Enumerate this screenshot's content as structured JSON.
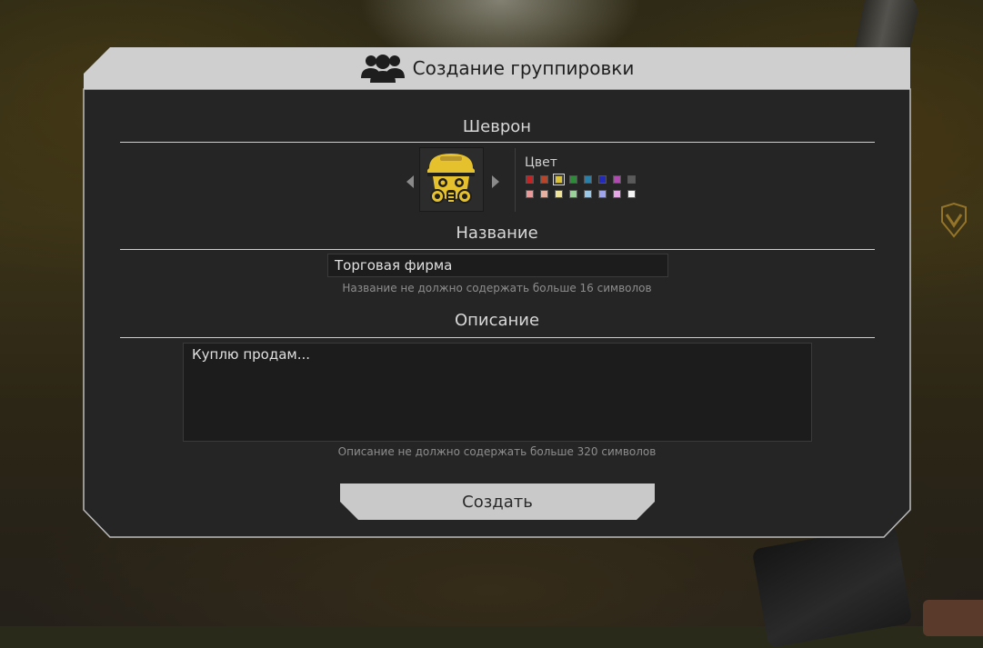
{
  "dialog": {
    "title": "Создание группировки",
    "title_icon": "group-icon"
  },
  "chevron": {
    "heading": "Шеврон",
    "icon": "gas-mask-helmet-emblem",
    "color_label": "Цвет",
    "colors_row1": [
      "#c02424",
      "#b8452a",
      "#d9c23a",
      "#2f8a3a",
      "#2a7fa8",
      "#242ab8",
      "#b04ab0",
      "#5a5a5a"
    ],
    "colors_row2": [
      "#e89a9a",
      "#e8b0a0",
      "#f0e49a",
      "#9ad09a",
      "#9ac8e6",
      "#a0a4ec",
      "#e6a8e6",
      "#f4f4f4"
    ],
    "selected_color": "#d9c23a"
  },
  "name": {
    "heading": "Название",
    "value": "Торговая фирма",
    "hint": "Название не должно содержать больше 16 символов"
  },
  "description": {
    "heading": "Описание",
    "value": "Куплю продам...",
    "hint": "Описание не должно содержать больше 320 символов"
  },
  "actions": {
    "create_label": "Создать"
  }
}
